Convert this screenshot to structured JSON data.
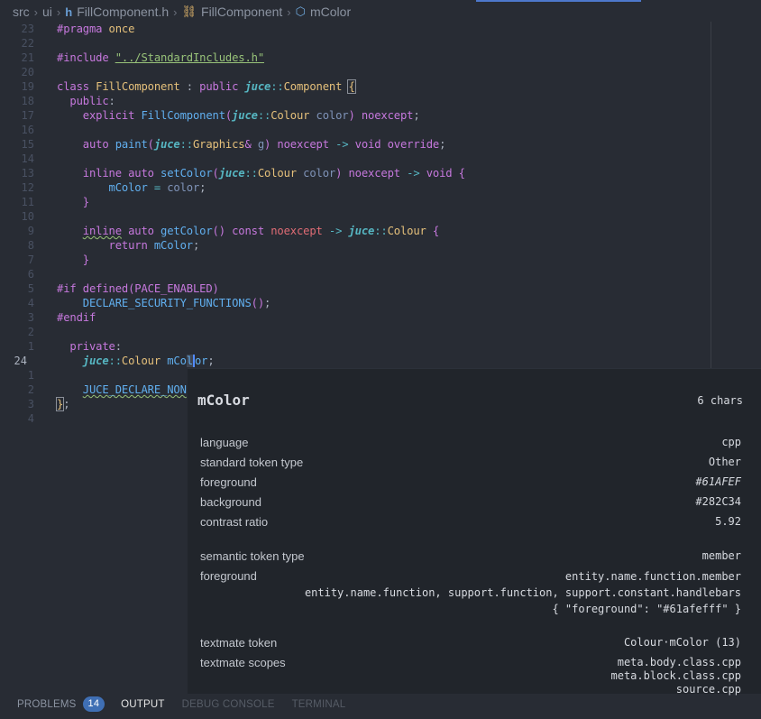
{
  "breadcrumb": {
    "items": [
      "src",
      "ui",
      "FillComponent.h",
      "FillComponent",
      "mColor"
    ]
  },
  "editor": {
    "line_numbers": [
      "23",
      "22",
      "21",
      "20",
      "19",
      "18",
      "17",
      "16",
      "15",
      "14",
      "13",
      "12",
      "11",
      "10",
      "9",
      "8",
      "7",
      "6",
      "5",
      "4",
      "3",
      "2",
      "1",
      "24",
      "1",
      "2",
      "3",
      "4"
    ]
  },
  "hover": {
    "title": "mColor",
    "chars": "6 chars",
    "rows": [
      {
        "key": "language",
        "value": "cpp"
      },
      {
        "key": "standard token type",
        "value": "Other"
      },
      {
        "key": "foreground",
        "value": "#61AFEF"
      },
      {
        "key": "background",
        "value": "#282C34"
      },
      {
        "key": "contrast ratio",
        "value": "5.92"
      },
      {
        "key": "semantic token type",
        "value": "member"
      },
      {
        "key": "foreground",
        "value": "entity.name.function.member\nentity.name.function, support.function, support.constant.handlebars\n{ \"foreground\": \"#61afefff\" }"
      },
      {
        "key": "textmate token",
        "value": "Colour·mColor (13)"
      },
      {
        "key": "textmate scopes",
        "value": "meta.body.class.cpp\nmeta.block.class.cpp\nsource.cpp"
      }
    ]
  },
  "panel": {
    "tabs": [
      "PROBLEMS",
      "OUTPUT",
      "DEBUG CONSOLE",
      "TERMINAL"
    ],
    "problems_count": "14"
  },
  "colors": {
    "background": "#282c34",
    "accent": "#4d78cc",
    "function": "#61afef",
    "keyword": "#c678dd",
    "type": "#e5c07b",
    "string": "#98c379"
  }
}
